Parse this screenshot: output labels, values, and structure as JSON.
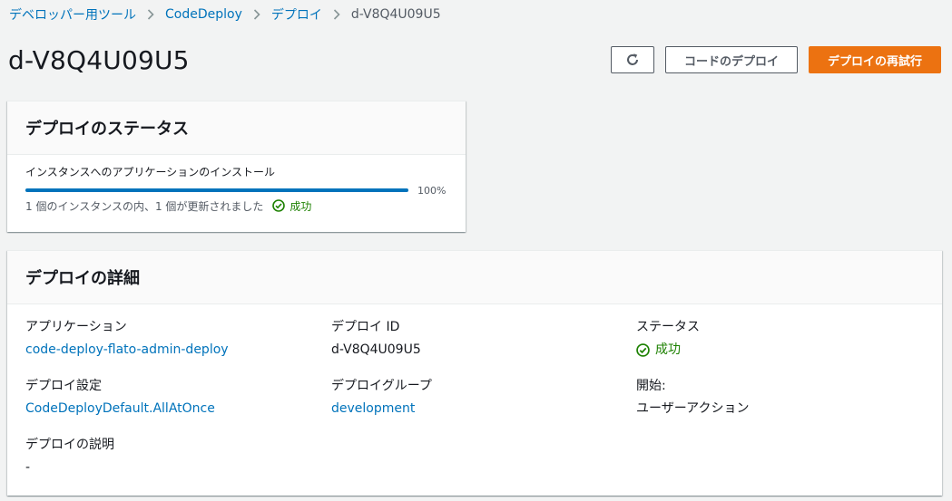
{
  "breadcrumb": {
    "items": [
      "デベロッパー用ツール",
      "CodeDeploy",
      "デプロイ"
    ],
    "current": "d-V8Q4U09U5"
  },
  "page": {
    "title": "d-V8Q4U09U5"
  },
  "actions": {
    "refresh_icon": "refresh-icon",
    "deploy_code": "コードのデプロイ",
    "retry_deploy": "デプロイの再試行"
  },
  "status_card": {
    "title": "デプロイのステータス",
    "progress_label": "インスタンスへのアプリケーションのインストール",
    "progress_percent": 100,
    "progress_text": "100%",
    "instances_text": "1 個のインスタンスの内、1 個が更新されました",
    "status": "成功"
  },
  "details_card": {
    "title": "デプロイの詳細",
    "fields": {
      "application_label": "アプリケーション",
      "application_value": "code-deploy-flato-admin-deploy",
      "deploy_id_label": "デプロイ ID",
      "deploy_id_value": "d-V8Q4U09U5",
      "status_label": "ステータス",
      "status_value": "成功",
      "config_label": "デプロイ設定",
      "config_value": "CodeDeployDefault.AllAtOnce",
      "group_label": "デプロイグループ",
      "group_value": "development",
      "start_label": "開始:",
      "start_value": "ユーザーアクション",
      "description_label": "デプロイの説明",
      "description_value": "-"
    }
  },
  "colors": {
    "link": "#0073bb",
    "success": "#1d8102",
    "primary": "#ec7211",
    "background": "#f2f3f3"
  }
}
